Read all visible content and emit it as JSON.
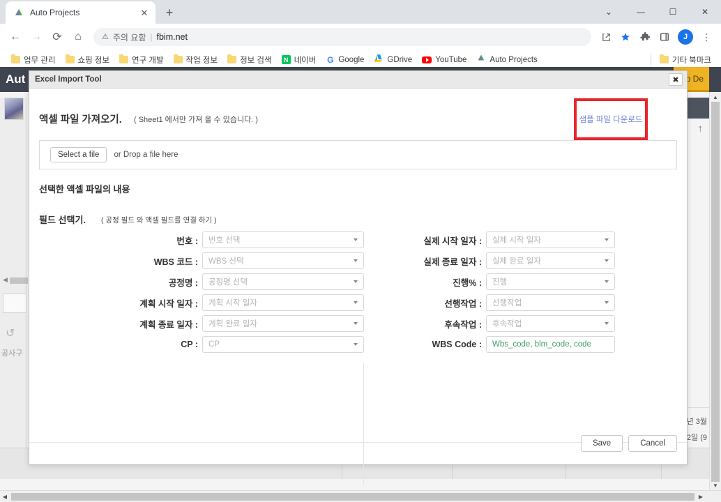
{
  "browser": {
    "tab": {
      "title": "Auto Projects",
      "favicon_icon": "auto-projects-favicon",
      "close_icon": "close-icon"
    },
    "new_tab_label": "+",
    "window_controls": [
      {
        "name": "tab-search-button",
        "glyph": "⌄"
      },
      {
        "name": "minimize-button",
        "glyph": "—"
      },
      {
        "name": "maximize-button",
        "glyph": "☐"
      },
      {
        "name": "close-window-button",
        "glyph": "✕"
      }
    ],
    "nav": {
      "back_glyph": "←",
      "forward_glyph": "→",
      "reload_glyph": "⟳",
      "home_glyph": "⌂"
    },
    "omnibox": {
      "warning_glyph": "⚠",
      "security_text": "주의 요함",
      "separator": "|",
      "url": "fbim.net"
    },
    "toolbar_icons": [
      {
        "name": "share-icon",
        "glyph": "⤻"
      },
      {
        "name": "bookmark-star-icon",
        "glyph": "★"
      },
      {
        "name": "extensions-puzzle-icon",
        "glyph": "✦"
      },
      {
        "name": "side-panel-icon",
        "glyph": "◫"
      }
    ],
    "profile_initial": "J",
    "menu_glyph": "⋮",
    "bookmarks": [
      {
        "label": "업무 관리",
        "icon": "folder-icon"
      },
      {
        "label": "쇼핑 정보",
        "icon": "folder-icon"
      },
      {
        "label": "연구 개발",
        "icon": "folder-icon"
      },
      {
        "label": "작업 정보",
        "icon": "folder-icon"
      },
      {
        "label": "정보 검색",
        "icon": "folder-icon"
      },
      {
        "label": "네이버",
        "icon": "naver-icon"
      },
      {
        "label": "Google",
        "icon": "google-icon"
      },
      {
        "label": "GDrive",
        "icon": "gdrive-icon"
      },
      {
        "label": "YouTube",
        "icon": "youtube-icon"
      },
      {
        "label": "Auto Projects",
        "icon": "auto-projects-icon"
      }
    ],
    "other_bookmarks": {
      "label": "기타 북마크",
      "icon": "folder-icon"
    }
  },
  "page": {
    "app_title": "Aut",
    "help_desk_label": "elp De",
    "sidebar_label": "공사구",
    "right_text_1": "년 3월",
    "right_text_2": "2일 (9",
    "undo_glyph": "↺",
    "arrow_up_glyph": "↑"
  },
  "dialog": {
    "title": "Excel Import Tool",
    "close_glyph": "✖",
    "section1": {
      "heading": "액셀 파일 가져오기.",
      "note": "( Sheet1 에서만 가져 올 수 있습니다. )"
    },
    "download_link": "샘플 파일 다운로드",
    "download_box_color": "#e8252a",
    "dropzone": {
      "button_label": "Select a file",
      "text": "or Drop a file here"
    },
    "section2_heading": "선택한 액셀 파일의 내용",
    "section3": {
      "heading": "필드 선택기.",
      "note": "( 공정 필드 와 액셀 필드를 연결 하기 )"
    },
    "fields_left": [
      {
        "label": "번호 :",
        "placeholder": "번호 선택",
        "type": "select"
      },
      {
        "label": "WBS 코드 :",
        "placeholder": "WBS 선택",
        "type": "select"
      },
      {
        "label": "공정명 :",
        "placeholder": "공정명 선택",
        "type": "select"
      },
      {
        "label": "계획 시작 일자 :",
        "placeholder": "계획 시작 일자",
        "type": "select"
      },
      {
        "label": "계획 종료 일자 :",
        "placeholder": "계획 완료 일자",
        "type": "select"
      },
      {
        "label": "CP :",
        "placeholder": "CP",
        "type": "select"
      }
    ],
    "fields_right": [
      {
        "label": "실제 시작 일자 :",
        "placeholder": "실제 시작 일자",
        "type": "select"
      },
      {
        "label": "실제 종료 일자 :",
        "placeholder": "실제 완료 일자",
        "type": "select"
      },
      {
        "label": "진행% :",
        "placeholder": "진행",
        "type": "select"
      },
      {
        "label": "선행작업 :",
        "placeholder": "선행작업",
        "type": "select"
      },
      {
        "label": "후속작업 :",
        "placeholder": "후속작업",
        "type": "select"
      },
      {
        "label": "WBS Code :",
        "value": "Wbs_code, blm_code, code",
        "type": "text",
        "value_color": "#3d9e6a"
      }
    ],
    "footer": {
      "save_label": "Save",
      "cancel_label": "Cancel"
    }
  }
}
